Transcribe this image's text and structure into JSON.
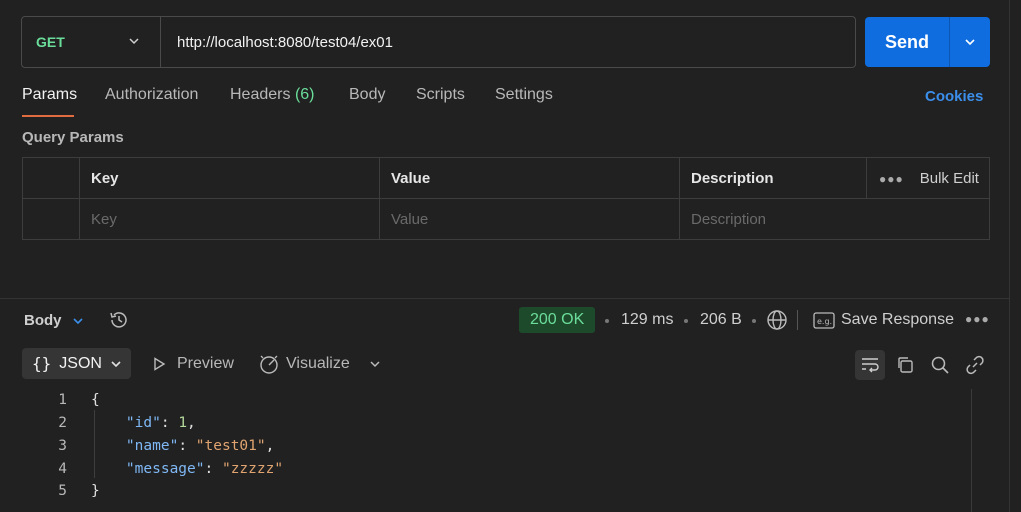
{
  "request": {
    "method": "GET",
    "url": "http://localhost:8080/test04/ex01",
    "send_label": "Send"
  },
  "tabs": [
    {
      "label": "Params",
      "active": true
    },
    {
      "label": "Authorization"
    },
    {
      "label": "Headers",
      "count": "(6)"
    },
    {
      "label": "Body"
    },
    {
      "label": "Scripts"
    },
    {
      "label": "Settings"
    }
  ],
  "cookies_label": "Cookies",
  "query_params": {
    "title": "Query Params",
    "columns": [
      "Key",
      "Value",
      "Description"
    ],
    "bulk_edit": "Bulk Edit",
    "placeholders": [
      "Key",
      "Value",
      "Description"
    ]
  },
  "response": {
    "body_label": "Body",
    "status": "200 OK",
    "time": "129 ms",
    "size": "206 B",
    "save_label": "Save Response",
    "format_label": "JSON",
    "preview_label": "Preview",
    "visualize_label": "Visualize"
  },
  "code_lines": [
    {
      "num": "1",
      "text": "{"
    },
    {
      "num": "2",
      "key": "\"id\"",
      "value": "1",
      "vtype": "n",
      "trail": ","
    },
    {
      "num": "3",
      "key": "\"name\"",
      "value": "\"test01\"",
      "vtype": "s",
      "trail": ","
    },
    {
      "num": "4",
      "key": "\"message\"",
      "value": "\"zzzzz\"",
      "vtype": "s",
      "trail": ""
    },
    {
      "num": "5",
      "text": "}"
    }
  ],
  "colors": {
    "accent": "#0f6ddf",
    "method_get": "#6bdd9a",
    "tab_active_underline": "#e06c3f",
    "status_ok_bg": "#1e4a2c",
    "link": "#3b8eea"
  }
}
